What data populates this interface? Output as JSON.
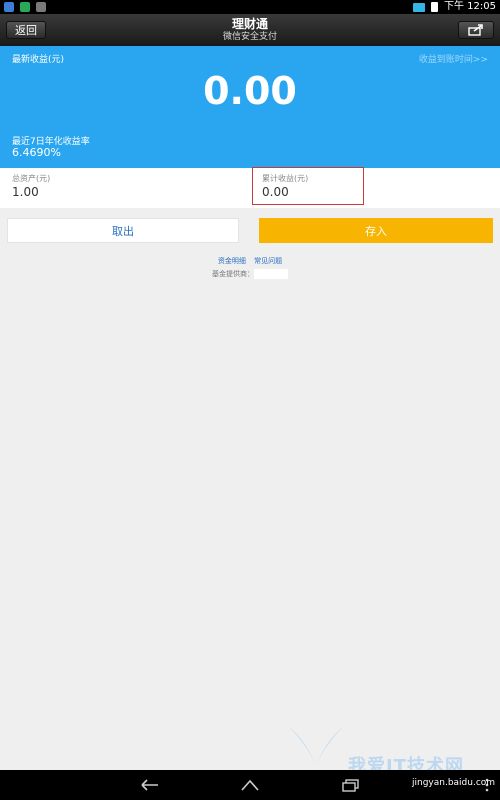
{
  "status_bar": {
    "time_label": "下午 12:05",
    "icon_colors": [
      "#3b7fd6",
      "#29a85a",
      "#7a7a7a"
    ]
  },
  "header": {
    "back_label": "返回",
    "title": "理财通",
    "subtitle": "微信安全支付",
    "share_icon": "share-icon"
  },
  "earnings": {
    "latest_label": "最新收益(元)",
    "latest_value": "0.00",
    "arrival_time_link": "收益到账时间>>",
    "rate_label": "最近7日年化收益率",
    "rate_value": "6.4690%"
  },
  "totals": {
    "assets_label": "总资产(元)",
    "assets_value": "1.00",
    "cumulative_label": "累计收益(元)",
    "cumulative_value": "0.00"
  },
  "actions": {
    "withdraw_label": "取出",
    "deposit_label": "存入"
  },
  "links": {
    "fund_details": "资金明细",
    "faq": "常见问题",
    "provider_label": "基金提供商："
  },
  "watermark": {
    "text": "我爱IT技术网",
    "url": "jingyan.baidu.com"
  },
  "colors": {
    "blue_panel": "#2aa6f1",
    "deposit_button": "#f7b400",
    "highlight_box": "#c83a3a",
    "link": "#2a6fbf"
  }
}
